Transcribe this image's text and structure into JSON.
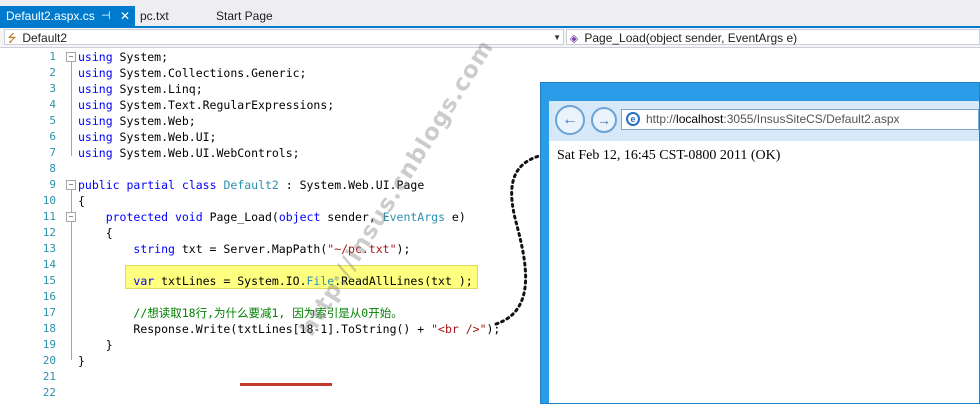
{
  "tabs": [
    {
      "label": "Default2.aspx.cs",
      "pin_icon": "pin-icon",
      "close_icon": "close-icon"
    },
    {
      "label": "pc.txt"
    },
    {
      "label": "Start Page"
    }
  ],
  "navbar": {
    "class_selector": "Default2",
    "class_icon": "class-icon",
    "member_selector": "Page_Load(object sender, EventArgs e)",
    "member_icon": "method-icon"
  },
  "code": {
    "line_numbers": [
      "1",
      "2",
      "3",
      "4",
      "5",
      "6",
      "7",
      "8",
      "9",
      "10",
      "11",
      "12",
      "13",
      "14",
      "15",
      "16",
      "17",
      "18",
      "19",
      "20",
      "21",
      "22"
    ],
    "l1": {
      "kw": "using",
      "rest": " System;"
    },
    "l2": {
      "kw": "using",
      "rest": " System.Collections.Generic;"
    },
    "l3": {
      "kw": "using",
      "rest": " System.Linq;"
    },
    "l4": {
      "kw": "using",
      "rest": " System.Text.RegularExpressions;"
    },
    "l5": {
      "kw": "using",
      "rest": " System.Web;"
    },
    "l6": {
      "kw": "using",
      "rest": " System.Web.UI;"
    },
    "l7": {
      "kw": "using",
      "rest": " System.Web.UI.WebControls;"
    },
    "l9": {
      "kw1": "public",
      "kw2": "partial",
      "kw3": "class",
      "type": "Default2",
      "rest": " : System.Web.UI.Page"
    },
    "l10": "{",
    "l11": {
      "kw1": "protected",
      "kw2": "void",
      "name": " Page_Load(",
      "kw3": "object",
      "p1": " sender, ",
      "type": "EventArgs",
      "p2": " e)"
    },
    "l12": "{",
    "l13": {
      "kw": "string",
      "rest": " txt = Server.MapPath(",
      "str": "\"~/pc.txt\"",
      "end": ");"
    },
    "l15": {
      "kw": "var",
      "p1": " txtLines = System.IO.",
      "type": "File",
      "p2": ".ReadAllLines(txt );"
    },
    "l17": "//想读取18行,为什么要减1, 因为索引是从0开始。",
    "l18": {
      "p1": "Response.Write(txtLines[18-1].ToString() + ",
      "str": "\"<br />\"",
      "end": ");"
    },
    "l19": "}",
    "l20": "}"
  },
  "watermark": "http://insus.cnblogs.com",
  "browser": {
    "back_icon": "back-arrow-icon",
    "forward_icon": "forward-arrow-icon",
    "url_prefix": "http://",
    "url_host": "localhost",
    "url_rest": ":3055/InsusSiteCS/Default2.aspx",
    "output": "Sat Feb 12, 16:45 CST-0800 2011 (OK)"
  },
  "colors": {
    "accent": "#007acc",
    "keyword": "#0000ff",
    "type": "#2b91af",
    "string": "#a31515",
    "comment": "#008000",
    "highlight": "#ffff80",
    "underline": "#c0392b"
  }
}
